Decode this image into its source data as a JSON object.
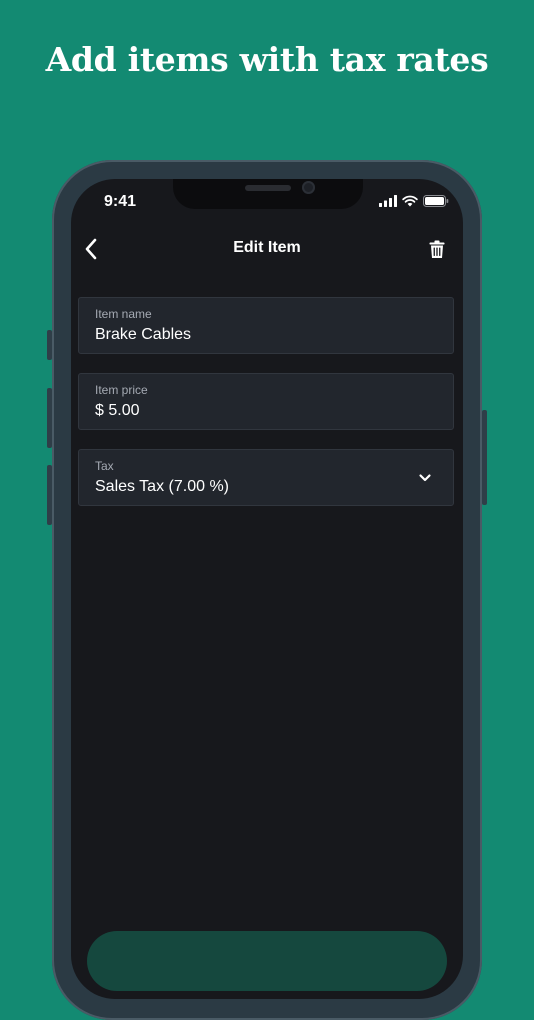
{
  "marketing": {
    "headline": "Add items with tax rates"
  },
  "status_bar": {
    "time": "9:41"
  },
  "nav": {
    "title": "Edit Item"
  },
  "fields": {
    "item_name": {
      "label": "Item name",
      "value": "Brake Cables"
    },
    "item_price": {
      "label": "Item price",
      "value": "$ 5.00"
    },
    "tax": {
      "label": "Tax",
      "value": "Sales Tax (7.00 %)"
    }
  },
  "icons": {
    "back": "chevron-left-icon",
    "delete": "trash-icon",
    "dropdown": "chevron-down-icon",
    "signal": "cellular-signal-icon",
    "wifi": "wifi-icon",
    "battery": "battery-icon"
  },
  "colors": {
    "background": "#138a72",
    "screen": "#17181c",
    "field": "#22262d",
    "text": "#ffffff",
    "label": "#a5aab3",
    "bottom_button": "#15483e"
  }
}
